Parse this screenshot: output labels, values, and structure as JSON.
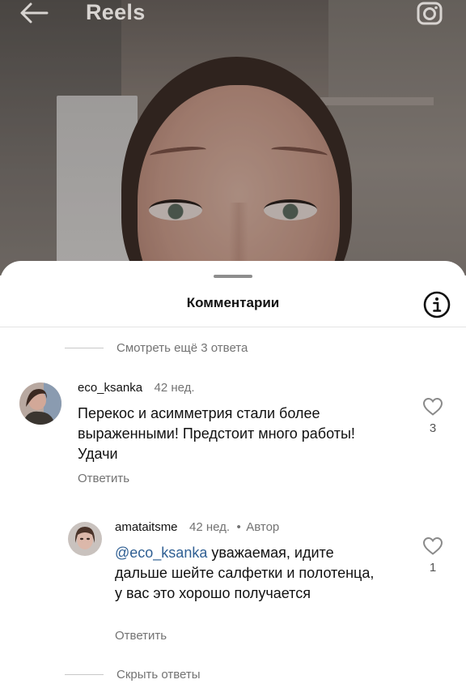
{
  "topbar": {
    "title": "Reels",
    "back_icon": "arrow-left-icon",
    "camera_icon": "camera-icon"
  },
  "sheet": {
    "title": "Комментарии",
    "info_icon": "info-icon"
  },
  "thread": {
    "view_more": "Смотреть ещё 3 ответа",
    "hide_replies": "Скрыть ответы"
  },
  "comments": [
    {
      "username": "eco_ksanka",
      "time": "42 нед.",
      "text": "Перекос и асимметрия стали более выраженными! Предстоит много работы! Удачи",
      "reply_label": "Ответить",
      "likes": "3"
    },
    {
      "username": "amataitsme",
      "time": "42 нед.",
      "author_label": "Автор",
      "separator": "•",
      "mention": "@eco_ksanka",
      "text": "уважаемая, идите дальше шейте салфетки и полотенца, у вас это хорошо получается",
      "reply_label": "Ответить",
      "likes": "1"
    }
  ],
  "colors": {
    "text_primary": "#111111",
    "text_secondary": "#737373",
    "mention": "#2f5f93",
    "divider": "#e3e3e3"
  }
}
